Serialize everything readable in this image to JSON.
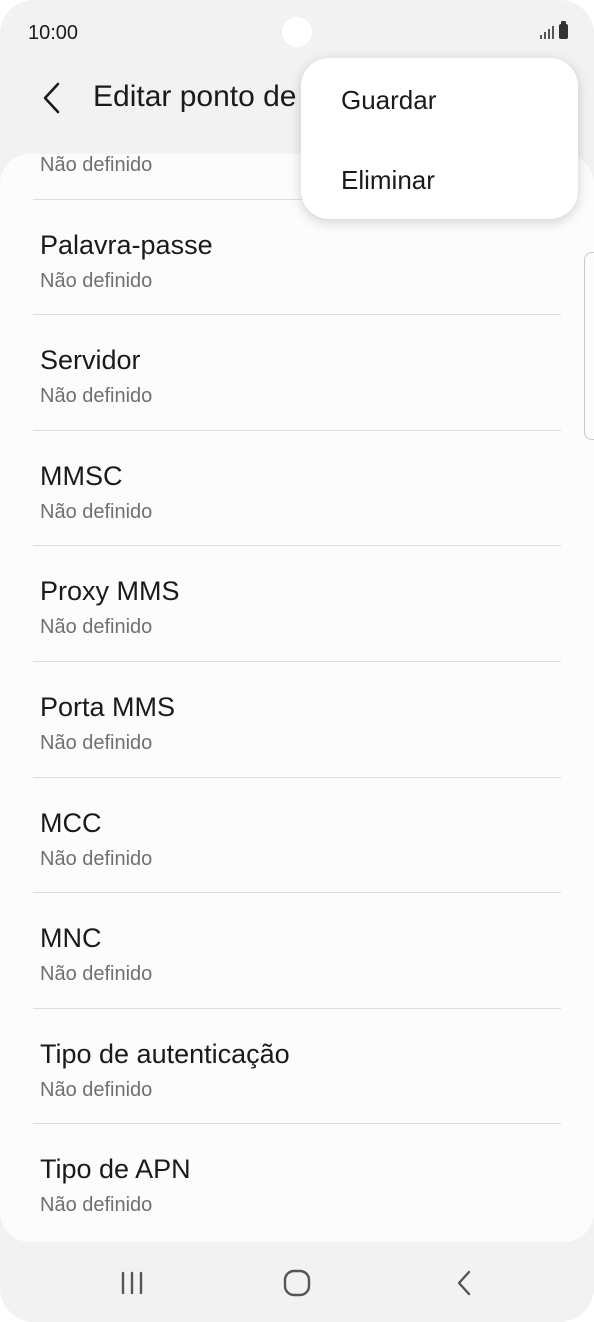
{
  "status_bar": {
    "time": "10:00",
    "icons": [
      "signal-icon",
      "battery-icon"
    ]
  },
  "app_bar": {
    "back_icon": "chevron-left-icon",
    "title": "Editar ponto de"
  },
  "popup_menu": {
    "items": [
      {
        "label": "Guardar"
      },
      {
        "label": "Eliminar"
      }
    ]
  },
  "list": {
    "items": [
      {
        "title": "",
        "value": "Não definido"
      },
      {
        "title": "Palavra-passe",
        "value": "Não definido"
      },
      {
        "title": "Servidor",
        "value": "Não definido"
      },
      {
        "title": "MMSC",
        "value": "Não definido"
      },
      {
        "title": "Proxy MMS",
        "value": "Não definido"
      },
      {
        "title": "Porta MMS",
        "value": "Não definido"
      },
      {
        "title": "MCC",
        "value": "Não definido"
      },
      {
        "title": "MNC",
        "value": "Não definido"
      },
      {
        "title": "Tipo de autenticação",
        "value": "Não definido"
      },
      {
        "title": "Tipo de APN",
        "value": "Não definido"
      }
    ]
  },
  "nav_bar": {
    "icons": [
      "recent-apps-icon",
      "home-icon",
      "back-icon"
    ]
  },
  "colors": {
    "background": "#f2f2f2",
    "card": "#fcfcfc",
    "text_primary": "#1a1a1a",
    "text_secondary": "#707070"
  }
}
